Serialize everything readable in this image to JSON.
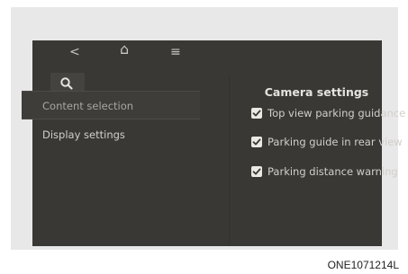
{
  "top_bar": {
    "back_icon": "<",
    "home_icon": "⌂",
    "menu_icon": "≡"
  },
  "icons": {
    "search": "search-icon",
    "checkbox": "checkmark-icon"
  },
  "left_menu": {
    "items": [
      {
        "label": "Content selection",
        "selected": true
      },
      {
        "label": "Display settings",
        "selected": false
      }
    ]
  },
  "right_panel": {
    "title": "Camera settings",
    "options": [
      {
        "label": "Top view parking guidance",
        "checked": true
      },
      {
        "label": "Parking guide in rear view",
        "checked": true
      },
      {
        "label": "Parking distance warning",
        "checked": true
      }
    ]
  },
  "figure_id": "ONE1071214L",
  "colors": {
    "screen_bg": "#3a3835",
    "frame_bg": "#e8e8e8",
    "text": "#d2cfc9"
  }
}
